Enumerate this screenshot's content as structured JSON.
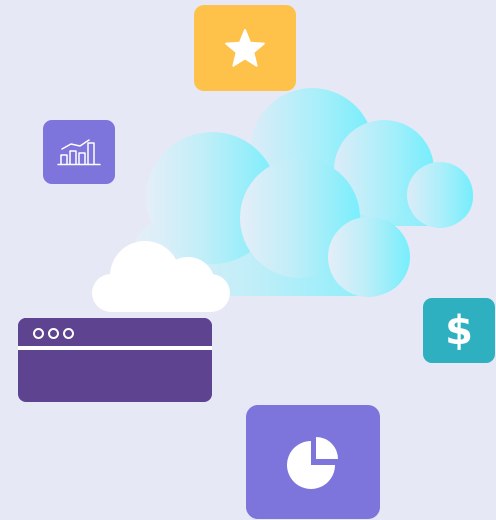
{
  "colors": {
    "background": "#e6e9f5",
    "star_tile": "#fec24a",
    "chart_tile": "#7d74dc",
    "dollar_tile": "#2fb0c0",
    "pie_tile": "#7d74dc",
    "browser_window": "#5e4390",
    "cloud_light": "#cfe9f8",
    "cloud_bright": "#7eeefc",
    "cloud_white": "#ffffff",
    "glyph": "#ffffff"
  },
  "icons": {
    "star": "star-icon",
    "chart": "bar-chart-icon",
    "dollar": "dollar-icon",
    "pie": "pie-chart-icon",
    "browser": "browser-window"
  },
  "glyphs": {
    "dollar": "$"
  }
}
